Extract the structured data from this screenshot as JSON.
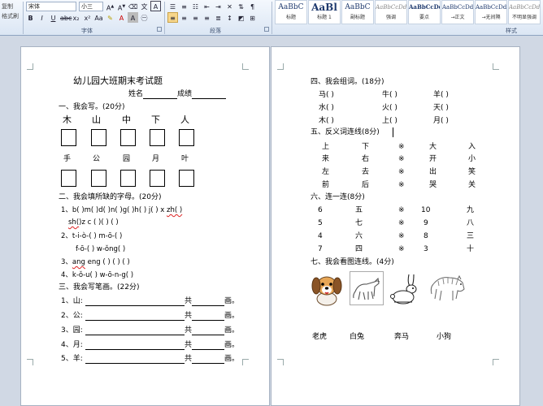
{
  "ribbon": {
    "clipboard": {
      "paste_label": "复制",
      "format_painter": "格式刷"
    },
    "font": {
      "name": "宋体",
      "size": "小三",
      "group_label": "字体"
    },
    "paragraph": {
      "group_label": "段落"
    },
    "styles": {
      "group_label": "样式",
      "tiles": [
        {
          "sample": "AaBbC",
          "name": "标题"
        },
        {
          "sample": "AaBl",
          "name": "标题 1"
        },
        {
          "sample": "AaBbC",
          "name": "副标题"
        },
        {
          "sample": "AaBbCcDd",
          "name": "强调"
        },
        {
          "sample": "AaBbCcDd",
          "name": "要点"
        },
        {
          "sample": "AaBbCcDd",
          "name": "→正文"
        },
        {
          "sample": "AaBbCcDd",
          "name": "→无间隔"
        },
        {
          "sample": "AaBbCcDd",
          "name": "不明显强调"
        }
      ]
    }
  },
  "left_page": {
    "title": "幼儿园大班期末考试题",
    "name_label": "姓名",
    "score_label": "成绩",
    "s1": {
      "heading": "一、我会写。(20分)",
      "row1": [
        "木",
        "山",
        "中",
        "下",
        "人"
      ],
      "row2": [
        "手",
        "公",
        "园",
        "月",
        "叶"
      ]
    },
    "s2": {
      "heading": "二、我会填所缺的字母。(20分)",
      "l1a": "1、b(   )m(   )d(   )n(   )g(   )h(   ) j(   ) x",
      "l1b": "zh(   )",
      "l2a": "sh(",
      "l2b": ")z  c  (   )(   ) (   )",
      "l3": "2、t-i-ò-(       )      m-ō-(       )",
      "l4": "f-ō-(     )    w-ǒng(       )",
      "l5a": "3、",
      "l5b": "ang",
      "l5c": " eng  (    )  (    )   (     )",
      "l6": "4、k-ǒ-u(      )      w-ō-n-g(      )"
    },
    "s3": {
      "heading": "三、我会写笔画。(22分)",
      "items": [
        {
          "label": "1、山:",
          "gong": "共",
          "hua": "画。"
        },
        {
          "label": "2、公:",
          "gong": "共",
          "hua": "画。"
        },
        {
          "label": "3、园:",
          "gong": "共",
          "hua": "画。"
        },
        {
          "label": "4、月:",
          "gong": "共",
          "hua": "画。"
        },
        {
          "label": "5、羊:",
          "gong": "共",
          "hua": "画。"
        }
      ]
    }
  },
  "right_page": {
    "s4": {
      "heading": "四、我会组词。(18分)",
      "rows": [
        [
          "马(          )",
          "牛(          )",
          "羊(          )"
        ],
        [
          "水(          )",
          "火(          )",
          "天(          )"
        ],
        [
          "木(          )",
          "上(          )",
          "月(          )"
        ]
      ]
    },
    "s5": {
      "heading": "五、反义词连线(8分)",
      "rows": [
        [
          "上",
          "下",
          "※",
          "大",
          "入"
        ],
        [
          "来",
          "右",
          "※",
          "开",
          "小"
        ],
        [
          "左",
          "去",
          "※",
          "出",
          "笑"
        ],
        [
          "前",
          "后",
          "※",
          "哭",
          "关"
        ]
      ]
    },
    "s6": {
      "heading": "六、连一连(8分)",
      "rows": [
        [
          "6",
          "五",
          "※",
          "10",
          "九"
        ],
        [
          "5",
          "七",
          "※",
          "9",
          "八"
        ],
        [
          "4",
          "六",
          "※",
          "8",
          "三"
        ],
        [
          "7",
          "四",
          "※",
          "3",
          "十"
        ]
      ]
    },
    "s7": {
      "heading": "七、我会看图连线。(4分)",
      "animals": [
        "老虎",
        "白兔",
        "奔马",
        "小狗"
      ]
    }
  }
}
